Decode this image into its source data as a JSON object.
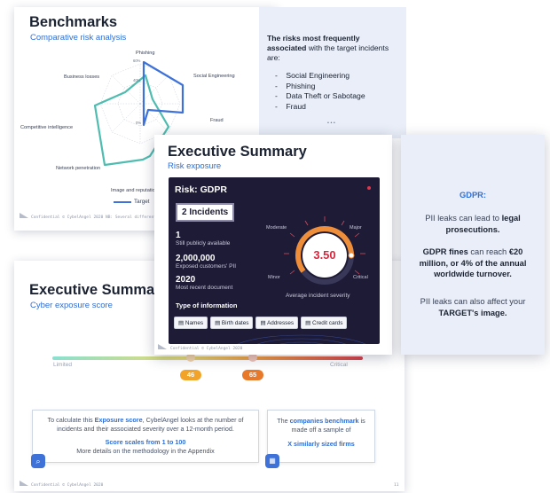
{
  "benchmarks": {
    "title": "Benchmarks",
    "subtitle": "Comparative risk analysis",
    "axes": [
      "Phishing",
      "Social Engineering",
      "Fraud",
      "Data Theft or Sabotage",
      "Image and reputation",
      "Network penetration",
      "Competitive intelligence",
      "Business losses"
    ],
    "ticks": [
      "60%",
      "40%",
      "0%"
    ],
    "legend_target": "Target",
    "footer": "Confidential © CybelAngel 2020 NB: Several different risks"
  },
  "risk_panel": {
    "intro_bold": "The risks most frequently associated",
    "intro_rest": " with the target incidents are:",
    "items": [
      "Social Engineering",
      "Phishing",
      "Data Theft or Sabotage",
      "Fraud"
    ],
    "ellipsis": "• • •"
  },
  "exec_bottom": {
    "title": "Executive Summary",
    "subtitle": "Cyber exposure score",
    "limited": "Limited",
    "critical": "Critical",
    "score_a": "46",
    "score_b": "65",
    "card1_pre": "To calculate this ",
    "card1_bold": "Exposure score",
    "card1_post": ", CybelAngel looks at the number of incidents and their associated severity over a 12-month period.",
    "card1_scale": "Score scales from 1 to 100",
    "card1_more": "More details on the methodology in the Appendix",
    "card2_pre": "The ",
    "card2_bold": "companies benchmark",
    "card2_post": " is made off a sample of",
    "card2_firms": "X similarly sized firms",
    "footer": "Confidential © CybelAngel 2020",
    "page": "11"
  },
  "exec_top": {
    "title": "Executive Summary",
    "subtitle": "Risk exposure",
    "risk_title": "Risk: GDPR",
    "incidents": "2 Incidents",
    "stat1_value": "1",
    "stat1_label": "Still publicly available",
    "stat2_value": "2,000,000",
    "stat2_label": "Exposed customers' PII",
    "stat3_value": "2020",
    "stat3_label": "Most recent document",
    "gauge_value": "3.50",
    "gauge_moderate": "Moderate",
    "gauge_major": "Major",
    "gauge_minor": "Minor",
    "gauge_critical": "Critical",
    "gauge_caption": "Average incident severity",
    "info_title": "Type of information",
    "chips": [
      "Names",
      "Birth dates",
      "Addresses",
      "Credit cards"
    ],
    "footer": "Confidential © CybelAngel 2020"
  },
  "gdpr": {
    "title": "GDPR:",
    "p1_pre": "PII leaks can lead to ",
    "p1_bold": "legal prosecutions.",
    "p2_bold1": "GDPR fines",
    "p2_mid": " can reach ",
    "p2_bold2": "€20 million, or 4% of the annual worldwide turnover.",
    "p3_pre": "PII leaks can also affect your ",
    "p3_bold": "TARGET's image."
  },
  "colors": {
    "target": "#3f72d9",
    "benchmark": "#4fbcb0",
    "accent": "#2f6fd6",
    "dark_card": "#1d1b36",
    "pill_a": "#f2a42a",
    "pill_b": "#e8792a"
  }
}
